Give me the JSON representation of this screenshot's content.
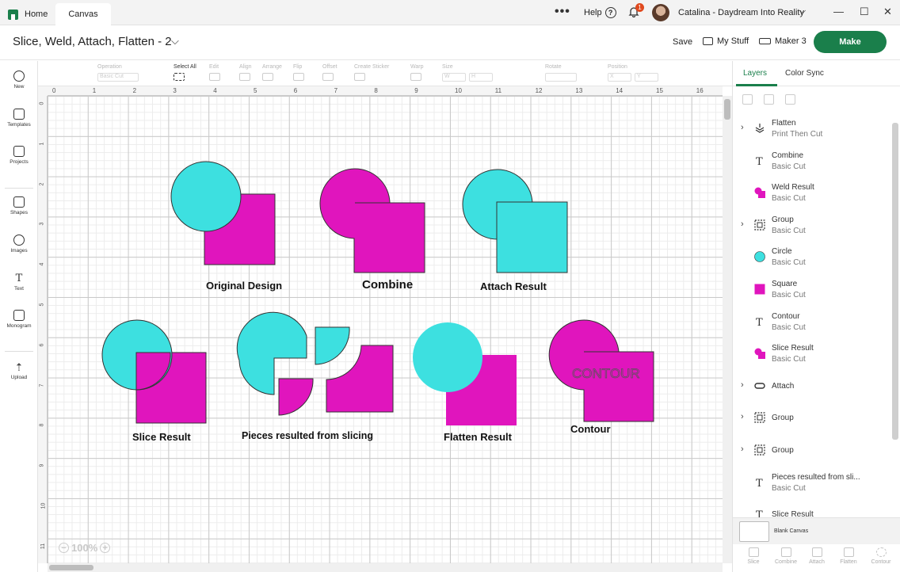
{
  "titlebar": {
    "home_tab": "Home",
    "canvas_tab": "Canvas",
    "more": "•••",
    "help": "Help",
    "help_icon": "?",
    "notification_count": "1",
    "user_name": "Catalina - Daydream Into Reality",
    "user_chevron": "⌵",
    "minimize": "—",
    "maximize": "☐",
    "close": "✕"
  },
  "header": {
    "project_title": "Slice, Weld, Attach, Flatten - 2",
    "title_chevron": "⌵",
    "save_label": "Save",
    "mystuff_label": "My Stuff",
    "machine_label": "Maker 3",
    "make_label": "Make"
  },
  "toolbar": {
    "undo": "↶",
    "redo": "↷",
    "operation_label": "Operation",
    "operation_value": "Basic Cut",
    "select_all_label": "Select All",
    "edit_label": "Edit",
    "align_label": "Align",
    "arrange_label": "Arrange",
    "flip_label": "Flip",
    "offset_label": "Offset",
    "create_sticker_label": "Create Sticker",
    "warp_label": "Warp",
    "size_label": "Size",
    "w_label": "W",
    "h_label": "H",
    "rotate_label": "Rotate",
    "position_label": "Position",
    "x_label": "X",
    "y_label": "Y"
  },
  "leftbar": {
    "items": [
      {
        "label": "New",
        "icon": "plus-icon"
      },
      {
        "label": "Templates",
        "icon": "shirt-icon"
      },
      {
        "label": "Projects",
        "icon": "projects-icon"
      },
      {
        "label": "Shapes",
        "icon": "shapes-icon"
      },
      {
        "label": "Images",
        "icon": "bulb-icon"
      },
      {
        "label": "Text",
        "icon": "text-icon"
      },
      {
        "label": "Monogram",
        "icon": "monogram-icon"
      },
      {
        "label": "Upload",
        "icon": "upload-icon"
      }
    ]
  },
  "ruler": {
    "top": [
      "0",
      "1",
      "2",
      "3",
      "4",
      "5",
      "6",
      "7",
      "8",
      "9",
      "10",
      "11",
      "12",
      "13",
      "14",
      "15",
      "16"
    ],
    "left": [
      "0",
      "1",
      "2",
      "3",
      "4",
      "5",
      "6",
      "7",
      "8",
      "9",
      "10",
      "11"
    ]
  },
  "canvas": {
    "colors": {
      "cyan": "#3de0e0",
      "magenta": "#e015bd",
      "outline": "#333333"
    },
    "labels": {
      "original": "Original Design",
      "combine": "Combine",
      "attach": "Attach Result",
      "slice": "Slice Result",
      "pieces": "Pieces resulted from slicing",
      "flatten": "Flatten Result",
      "contour": "Contour",
      "contour_text": "CONTOUR"
    },
    "zoom_out": "−",
    "zoom_in": "+",
    "zoom_level": "100%"
  },
  "rightpanel": {
    "tabs": {
      "layers": "Layers",
      "color_sync": "Color Sync"
    },
    "layers": [
      {
        "name": "Flatten",
        "sub": "Print Then Cut",
        "expandable": true,
        "icon": "flatten-icon"
      },
      {
        "name": "Combine",
        "sub": "Basic Cut",
        "expandable": false,
        "icon": "text-icon"
      },
      {
        "name": "Weld Result",
        "sub": "Basic Cut",
        "expandable": false,
        "icon": "weld-shape-icon"
      },
      {
        "name": "Group",
        "sub": "Basic Cut",
        "expandable": true,
        "icon": "group-icon"
      },
      {
        "name": "Circle",
        "sub": "Basic Cut",
        "expandable": false,
        "icon": "circle-shape-icon"
      },
      {
        "name": "Square",
        "sub": "Basic Cut",
        "expandable": false,
        "icon": "square-shape-icon"
      },
      {
        "name": "Contour",
        "sub": "Basic Cut",
        "expandable": false,
        "icon": "text-icon"
      },
      {
        "name": "Slice Result",
        "sub": "Basic Cut",
        "expandable": false,
        "icon": "weld-shape-icon"
      },
      {
        "name": "Attach",
        "sub": "",
        "expandable": true,
        "icon": "attach-icon"
      },
      {
        "name": "Group",
        "sub": "",
        "expandable": true,
        "icon": "group-icon"
      },
      {
        "name": "Group",
        "sub": "",
        "expandable": true,
        "icon": "group-icon"
      },
      {
        "name": "Pieces resulted from sli...",
        "sub": "Basic Cut",
        "expandable": false,
        "icon": "text-icon"
      },
      {
        "name": "Slice Result",
        "sub": "",
        "expandable": false,
        "icon": "text-icon"
      }
    ],
    "blank_canvas": "Blank Canvas",
    "bottom_actions": [
      "Slice",
      "Combine",
      "Attach",
      "Flatten",
      "Contour"
    ]
  }
}
